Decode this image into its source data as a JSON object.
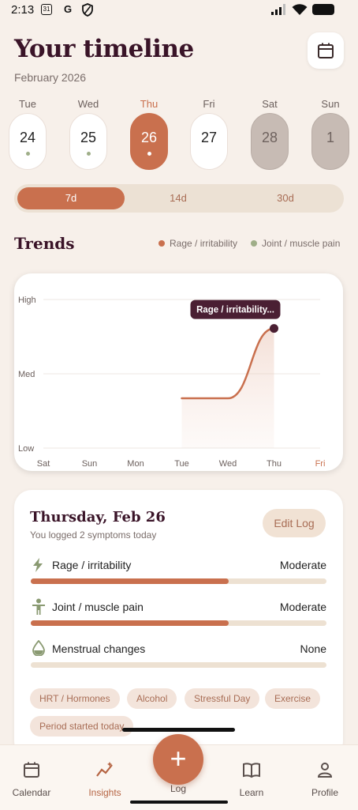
{
  "status": {
    "time": "2:13",
    "calendar_badge": "31",
    "g_letter": "G"
  },
  "header": {
    "title": "Your timeline",
    "subtitle": "February 2026"
  },
  "days": [
    {
      "weekday": "Tue",
      "date": "24",
      "state": "normal",
      "has_dot": true
    },
    {
      "weekday": "Wed",
      "date": "25",
      "state": "normal",
      "has_dot": true
    },
    {
      "weekday": "Thu",
      "date": "26",
      "state": "selected",
      "has_dot": true
    },
    {
      "weekday": "Fri",
      "date": "27",
      "state": "normal",
      "has_dot": false
    },
    {
      "weekday": "Sat",
      "date": "28",
      "state": "disabled",
      "has_dot": false
    },
    {
      "weekday": "Sun",
      "date": "1",
      "state": "disabled",
      "has_dot": false
    }
  ],
  "range": {
    "options": [
      "7d",
      "14d",
      "30d"
    ],
    "selected": "7d"
  },
  "trends": {
    "heading": "Trends",
    "legend": [
      {
        "label": "Rage / irritability",
        "color": "#c9704e"
      },
      {
        "label": "Joint / muscle pain",
        "color": "#9fae88"
      }
    ]
  },
  "chart_data": {
    "type": "area",
    "categories": [
      "Sat",
      "Sun",
      "Mon",
      "Tue",
      "Wed",
      "Thu",
      "Fri"
    ],
    "y_levels": [
      "Low",
      "Med",
      "High"
    ],
    "ylim": [
      0,
      2
    ],
    "series": [
      {
        "name": "Rage / irritability",
        "color": "#c9704e",
        "values": [
          null,
          null,
          null,
          0.67,
          0.67,
          1.61,
          null
        ]
      }
    ],
    "tooltip": "Rage / irritability...",
    "highlight_category": "Fri",
    "grid": true
  },
  "log": {
    "title": "Thursday, Feb 26",
    "subtitle": "You logged 2 symptoms today",
    "edit_label": "Edit Log",
    "symptoms": [
      {
        "name": "Rage / irritability",
        "value": "Moderate",
        "level": 0.67,
        "icon": "lightning-icon"
      },
      {
        "name": "Joint / muscle pain",
        "value": "Moderate",
        "level": 0.67,
        "icon": "person-icon"
      },
      {
        "name": "Menstrual changes",
        "value": "None",
        "level": 0,
        "icon": "droplet-icon"
      }
    ],
    "tags": [
      "HRT / Hormones",
      "Alcohol",
      "Stressful Day",
      "Exercise",
      "Period started today"
    ]
  },
  "nav": {
    "items": [
      {
        "label": "Calendar",
        "icon": "calendar-icon"
      },
      {
        "label": "Insights",
        "icon": "insights-icon"
      },
      {
        "label": "Log",
        "icon": "plus-icon"
      },
      {
        "label": "Learn",
        "icon": "book-icon"
      },
      {
        "label": "Profile",
        "icon": "person-icon"
      }
    ],
    "active": "Insights"
  }
}
